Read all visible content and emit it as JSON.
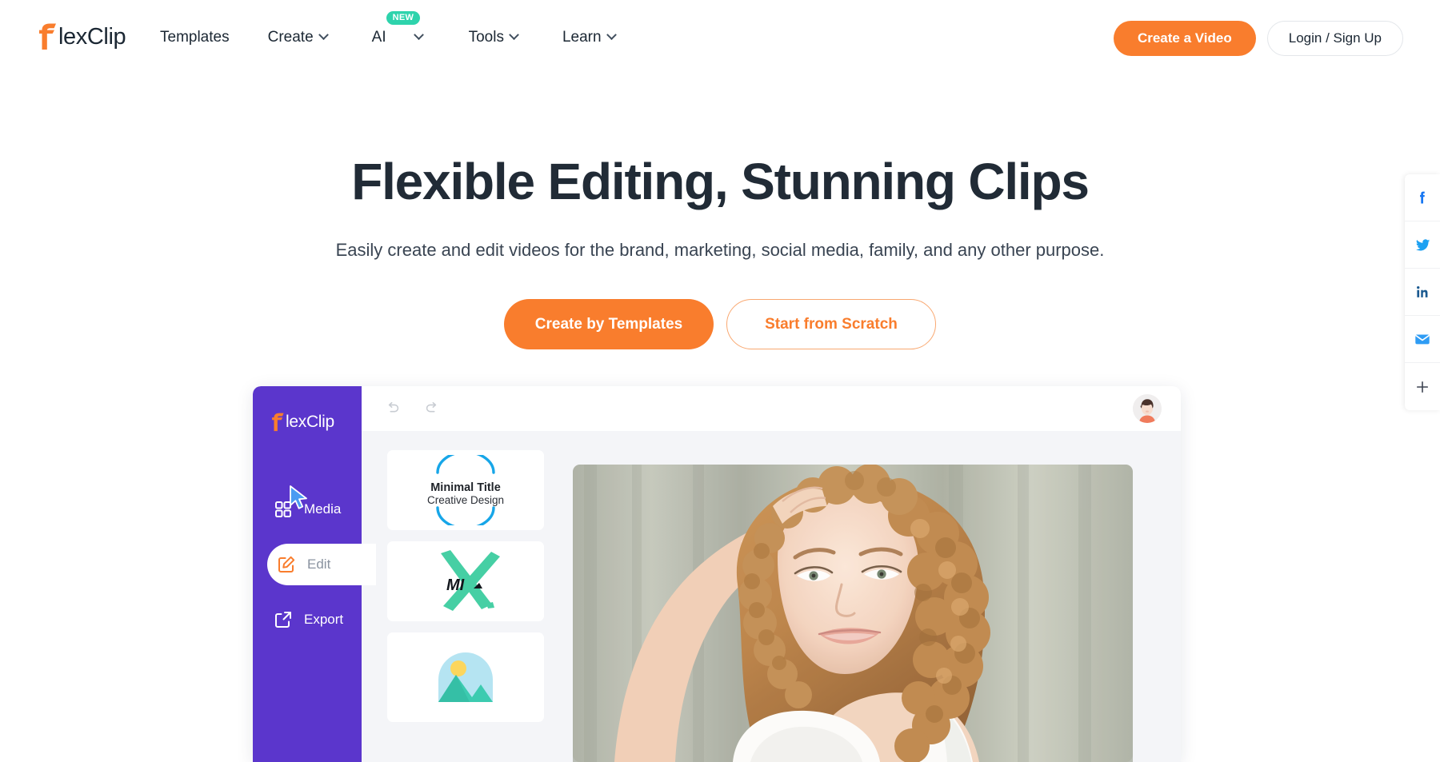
{
  "brand": {
    "name": "FlexClip",
    "logo_mark": "flexclip-f-logo",
    "accent_orange": "#f97d2d",
    "text_dark": "#1b2733",
    "editor_purple": "#5b36cc",
    "badge_teal": "#2ed3ac"
  },
  "header": {
    "logo_text": "lexClip",
    "nav": [
      {
        "label": "Templates",
        "has_chevron": false,
        "badge": null
      },
      {
        "label": "Create",
        "has_chevron": true,
        "badge": null
      },
      {
        "label": "AI",
        "has_chevron": true,
        "badge": "NEW"
      },
      {
        "label": "Tools",
        "has_chevron": true,
        "badge": null
      },
      {
        "label": "Learn",
        "has_chevron": true,
        "badge": null
      }
    ],
    "create_video_label": "Create a Video",
    "login_label": "Login / Sign Up"
  },
  "hero": {
    "title": "Flexible Editing, Stunning Clips",
    "subtitle": "Easily create and edit videos for the brand, marketing, social media, family, and any other purpose.",
    "primary_cta": "Create by Templates",
    "secondary_cta": "Start from Scratch"
  },
  "share_rail": {
    "items": [
      {
        "name": "facebook-icon",
        "color": "#1877f2"
      },
      {
        "name": "twitter-icon",
        "color": "#1da1f2"
      },
      {
        "name": "linkedin-icon",
        "color": "#1b5a90"
      },
      {
        "name": "email-icon",
        "color": "#2f9cf4"
      },
      {
        "name": "plus-icon",
        "color": "#3b4250"
      }
    ]
  },
  "editor_mockup": {
    "logo_text": "lexClip",
    "toolbar": {
      "undo": "undo-icon",
      "redo": "redo-icon",
      "avatar": "user-avatar"
    },
    "sidebar_items": [
      {
        "label": "Media",
        "icon": "grid-icon",
        "active": false
      },
      {
        "label": "Edit",
        "icon": "pencil-square-icon",
        "active": true
      },
      {
        "label": "Export",
        "icon": "export-icon",
        "active": false
      }
    ],
    "thumbnails": [
      {
        "name": "minimal-title-template",
        "title": "Minimal Title",
        "subtitle": "Creative Design"
      },
      {
        "name": "brush-x-template",
        "title": "MI",
        "subtitle": ""
      },
      {
        "name": "image-placeholder-template",
        "title": "",
        "subtitle": ""
      }
    ],
    "preview": {
      "name": "video-preview",
      "description": "Woman with curly auburn hair smiling, hand in hair, white top, soft curtain background"
    },
    "cursor": "pointer-cursor"
  }
}
